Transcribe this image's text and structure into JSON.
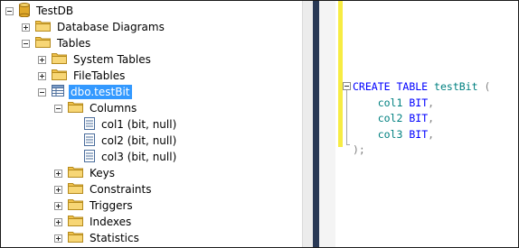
{
  "tree": {
    "database": "TestDB",
    "database_diagrams": "Database Diagrams",
    "tables": "Tables",
    "system_tables": "System Tables",
    "file_tables": "FileTables",
    "table": "dbo.testBit",
    "columns_folder": "Columns",
    "columns": [
      "col1 (bit, null)",
      "col2 (bit, null)",
      "col3 (bit, null)"
    ],
    "keys": "Keys",
    "constraints": "Constraints",
    "triggers": "Triggers",
    "indexes": "Indexes",
    "statistics": "Statistics"
  },
  "editor": {
    "create": "CREATE",
    "table": "TABLE",
    "table_name": "testBit",
    "open_paren": "(",
    "columns": [
      {
        "name": "col1",
        "type": "BIT",
        "sep": ","
      },
      {
        "name": "col2",
        "type": "BIT",
        "sep": ","
      },
      {
        "name": "col3",
        "type": "BIT",
        "sep": ","
      }
    ],
    "close": ");"
  },
  "colors": {
    "selection": "#3399ff",
    "keyword": "#0000ff",
    "identifier": "#008080",
    "punctuation": "#808080",
    "change_marker": "#f7ec43",
    "folder": "#e8b530"
  },
  "icons": {
    "database": "database-icon",
    "folder": "folder-icon",
    "table": "table-icon",
    "column": "column-icon"
  }
}
